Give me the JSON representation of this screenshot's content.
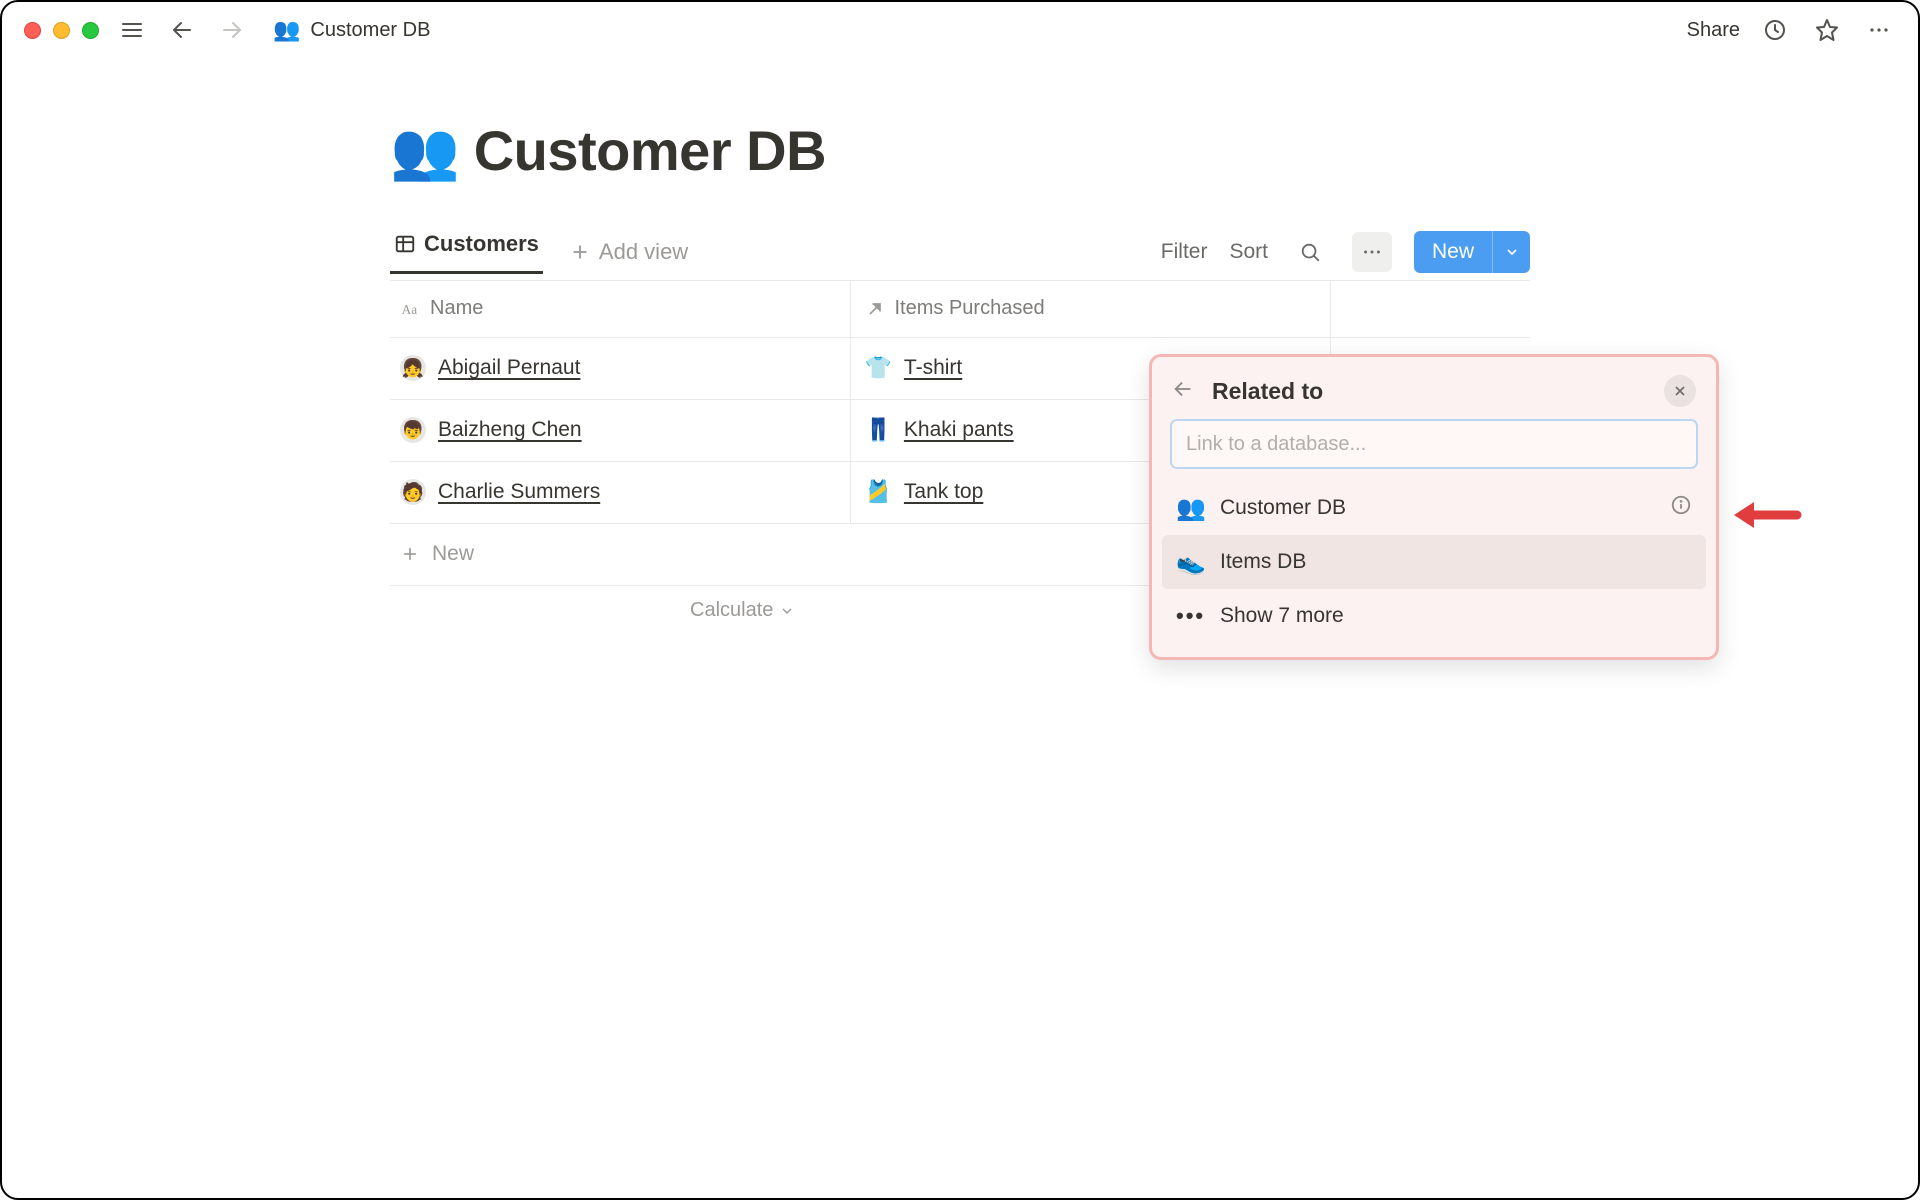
{
  "topbar": {
    "breadcrumb_icon": "👥",
    "breadcrumb_title": "Customer DB",
    "share_label": "Share"
  },
  "page": {
    "title_icon": "👥",
    "title": "Customer DB"
  },
  "views": {
    "active_tab_label": "Customers",
    "add_view_label": "Add view",
    "filter_label": "Filter",
    "sort_label": "Sort",
    "new_button_label": "New"
  },
  "table": {
    "columns": {
      "name": "Name",
      "items": "Items Purchased"
    },
    "rows": [
      {
        "avatar": "👧",
        "name": "Abigail Pernaut",
        "item_emoji": "👕",
        "item": "T-shirt"
      },
      {
        "avatar": "👦",
        "name": "Baizheng Chen",
        "item_emoji": "👖",
        "item": "Khaki pants"
      },
      {
        "avatar": "🧑",
        "name": "Charlie Summers",
        "item_emoji": "🎽",
        "item": "Tank top"
      }
    ],
    "new_row_label": "New",
    "calculate_label": "Calculate"
  },
  "popover": {
    "title": "Related to",
    "search_placeholder": "Link to a database...",
    "options": [
      {
        "emoji": "👥",
        "label": "Customer DB",
        "has_info": true,
        "highlight": false
      },
      {
        "emoji": "👟",
        "label": "Items DB",
        "has_info": false,
        "highlight": true
      }
    ],
    "show_more_label": "Show 7 more"
  }
}
